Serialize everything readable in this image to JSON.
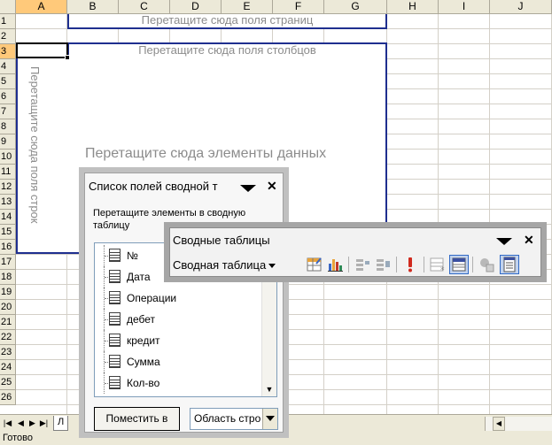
{
  "sheet": {
    "columns": [
      "A",
      "B",
      "C",
      "D",
      "E",
      "F",
      "G",
      "H",
      "I",
      "J"
    ],
    "rows": [
      "1",
      "2",
      "3",
      "4",
      "5",
      "6",
      "7",
      "8",
      "9",
      "10",
      "11",
      "12",
      "13",
      "14",
      "15",
      "16",
      "17",
      "18",
      "19",
      "20",
      "21",
      "22",
      "23",
      "24",
      "25",
      "26"
    ],
    "selected_column": "A",
    "selected_row": "3"
  },
  "pivot": {
    "page_zone": "Перетащите сюда поля страниц",
    "column_zone": "Перетащите сюда поля столбцов",
    "row_zone": "Перетащите сюда поля строк",
    "data_zone": "Перетащите сюда элементы данных"
  },
  "field_list": {
    "title": "Список полей сводной т",
    "instructions": "Перетащите элементы в сводную таблицу",
    "fields": [
      "№",
      "Дата",
      "Операции",
      "дебет",
      "кредит",
      "Сумма",
      "Кол-во"
    ],
    "add_button": "Поместить в",
    "area_value": "Область стро"
  },
  "toolbar": {
    "title": "Сводные таблицы",
    "menu_pre": "Сво",
    "menu_underlined": "д",
    "menu_post": "ная таблица",
    "buttons": [
      {
        "icon": "format-report-icon",
        "pressed": false
      },
      {
        "icon": "chart-wizard-icon",
        "pressed": false
      },
      {
        "icon": "hide-detail-icon",
        "pressed": false
      },
      {
        "icon": "show-detail-icon",
        "pressed": false
      },
      {
        "icon": "refresh-data-icon",
        "pressed": false
      },
      {
        "icon": "include-hidden-items-icon",
        "pressed": false
      },
      {
        "icon": "always-display-items-icon",
        "pressed": true
      },
      {
        "icon": "field-settings-icon",
        "pressed": false
      },
      {
        "icon": "show-field-list-icon",
        "pressed": true
      }
    ]
  },
  "tabs": {
    "partial_tab": "Л"
  },
  "status": {
    "text": "Готово"
  },
  "colors": {
    "pivot_border": "#1f2f8f",
    "selection_header": "#ffc97a",
    "chrome": "#ece9d8"
  }
}
